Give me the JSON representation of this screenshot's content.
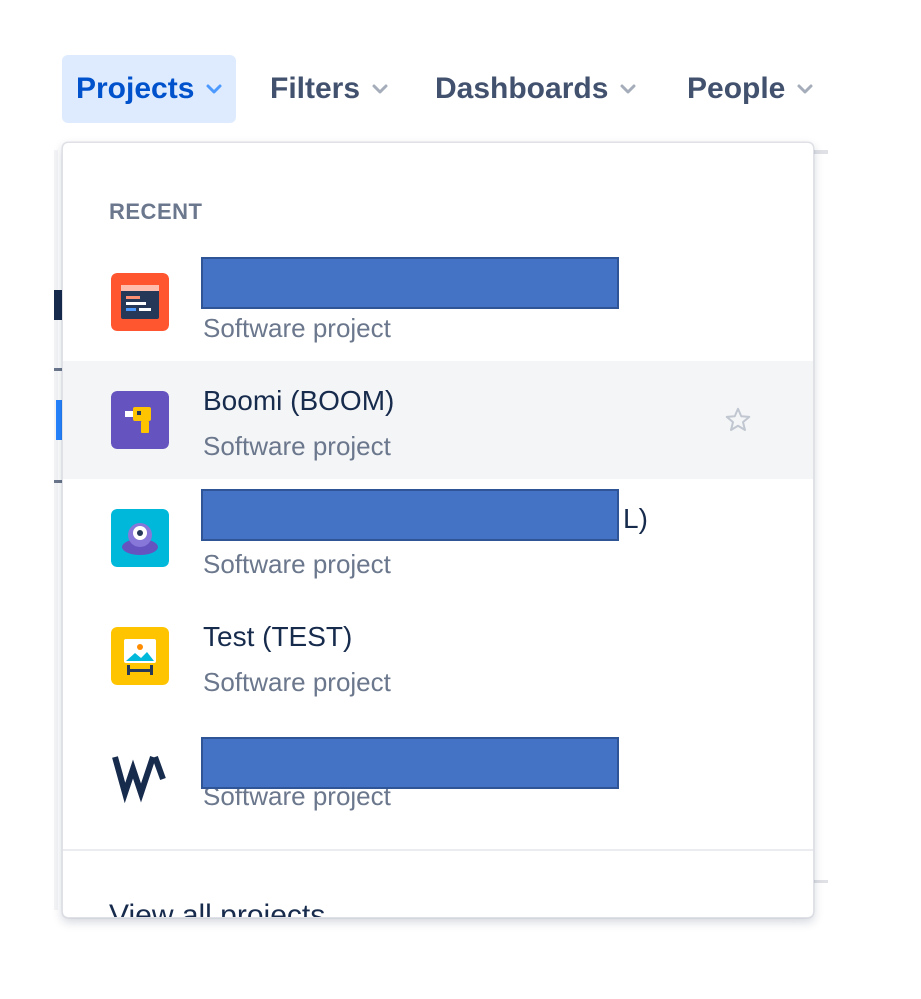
{
  "nav": {
    "items": [
      {
        "label": "Projects",
        "active": true
      },
      {
        "label": "Filters",
        "active": false
      },
      {
        "label": "Dashboards",
        "active": false
      },
      {
        "label": "People",
        "active": false
      }
    ]
  },
  "dropdown": {
    "heading": "RECENT",
    "projects": [
      {
        "title": "",
        "subtitle": "Software project",
        "redacted": true,
        "icon": "code-editor-icon"
      },
      {
        "title": "Boomi (BOOM)",
        "subtitle": "Software project",
        "redacted": false,
        "icon": "drill-icon"
      },
      {
        "title": "L)",
        "subtitle": "Software project",
        "redacted": true,
        "icon": "robot-icon"
      },
      {
        "title": "Test (TEST)",
        "subtitle": "Software project",
        "redacted": false,
        "icon": "easel-icon"
      },
      {
        "title": "",
        "subtitle": "Software project",
        "redacted": true,
        "icon": "w-logo-icon"
      }
    ],
    "view_all": "View all projects"
  },
  "colors": {
    "active_nav_bg": "#deebff",
    "active_nav_text": "#0052cc",
    "redaction": "#4472c4",
    "hover_row": "#f4f5f7"
  }
}
